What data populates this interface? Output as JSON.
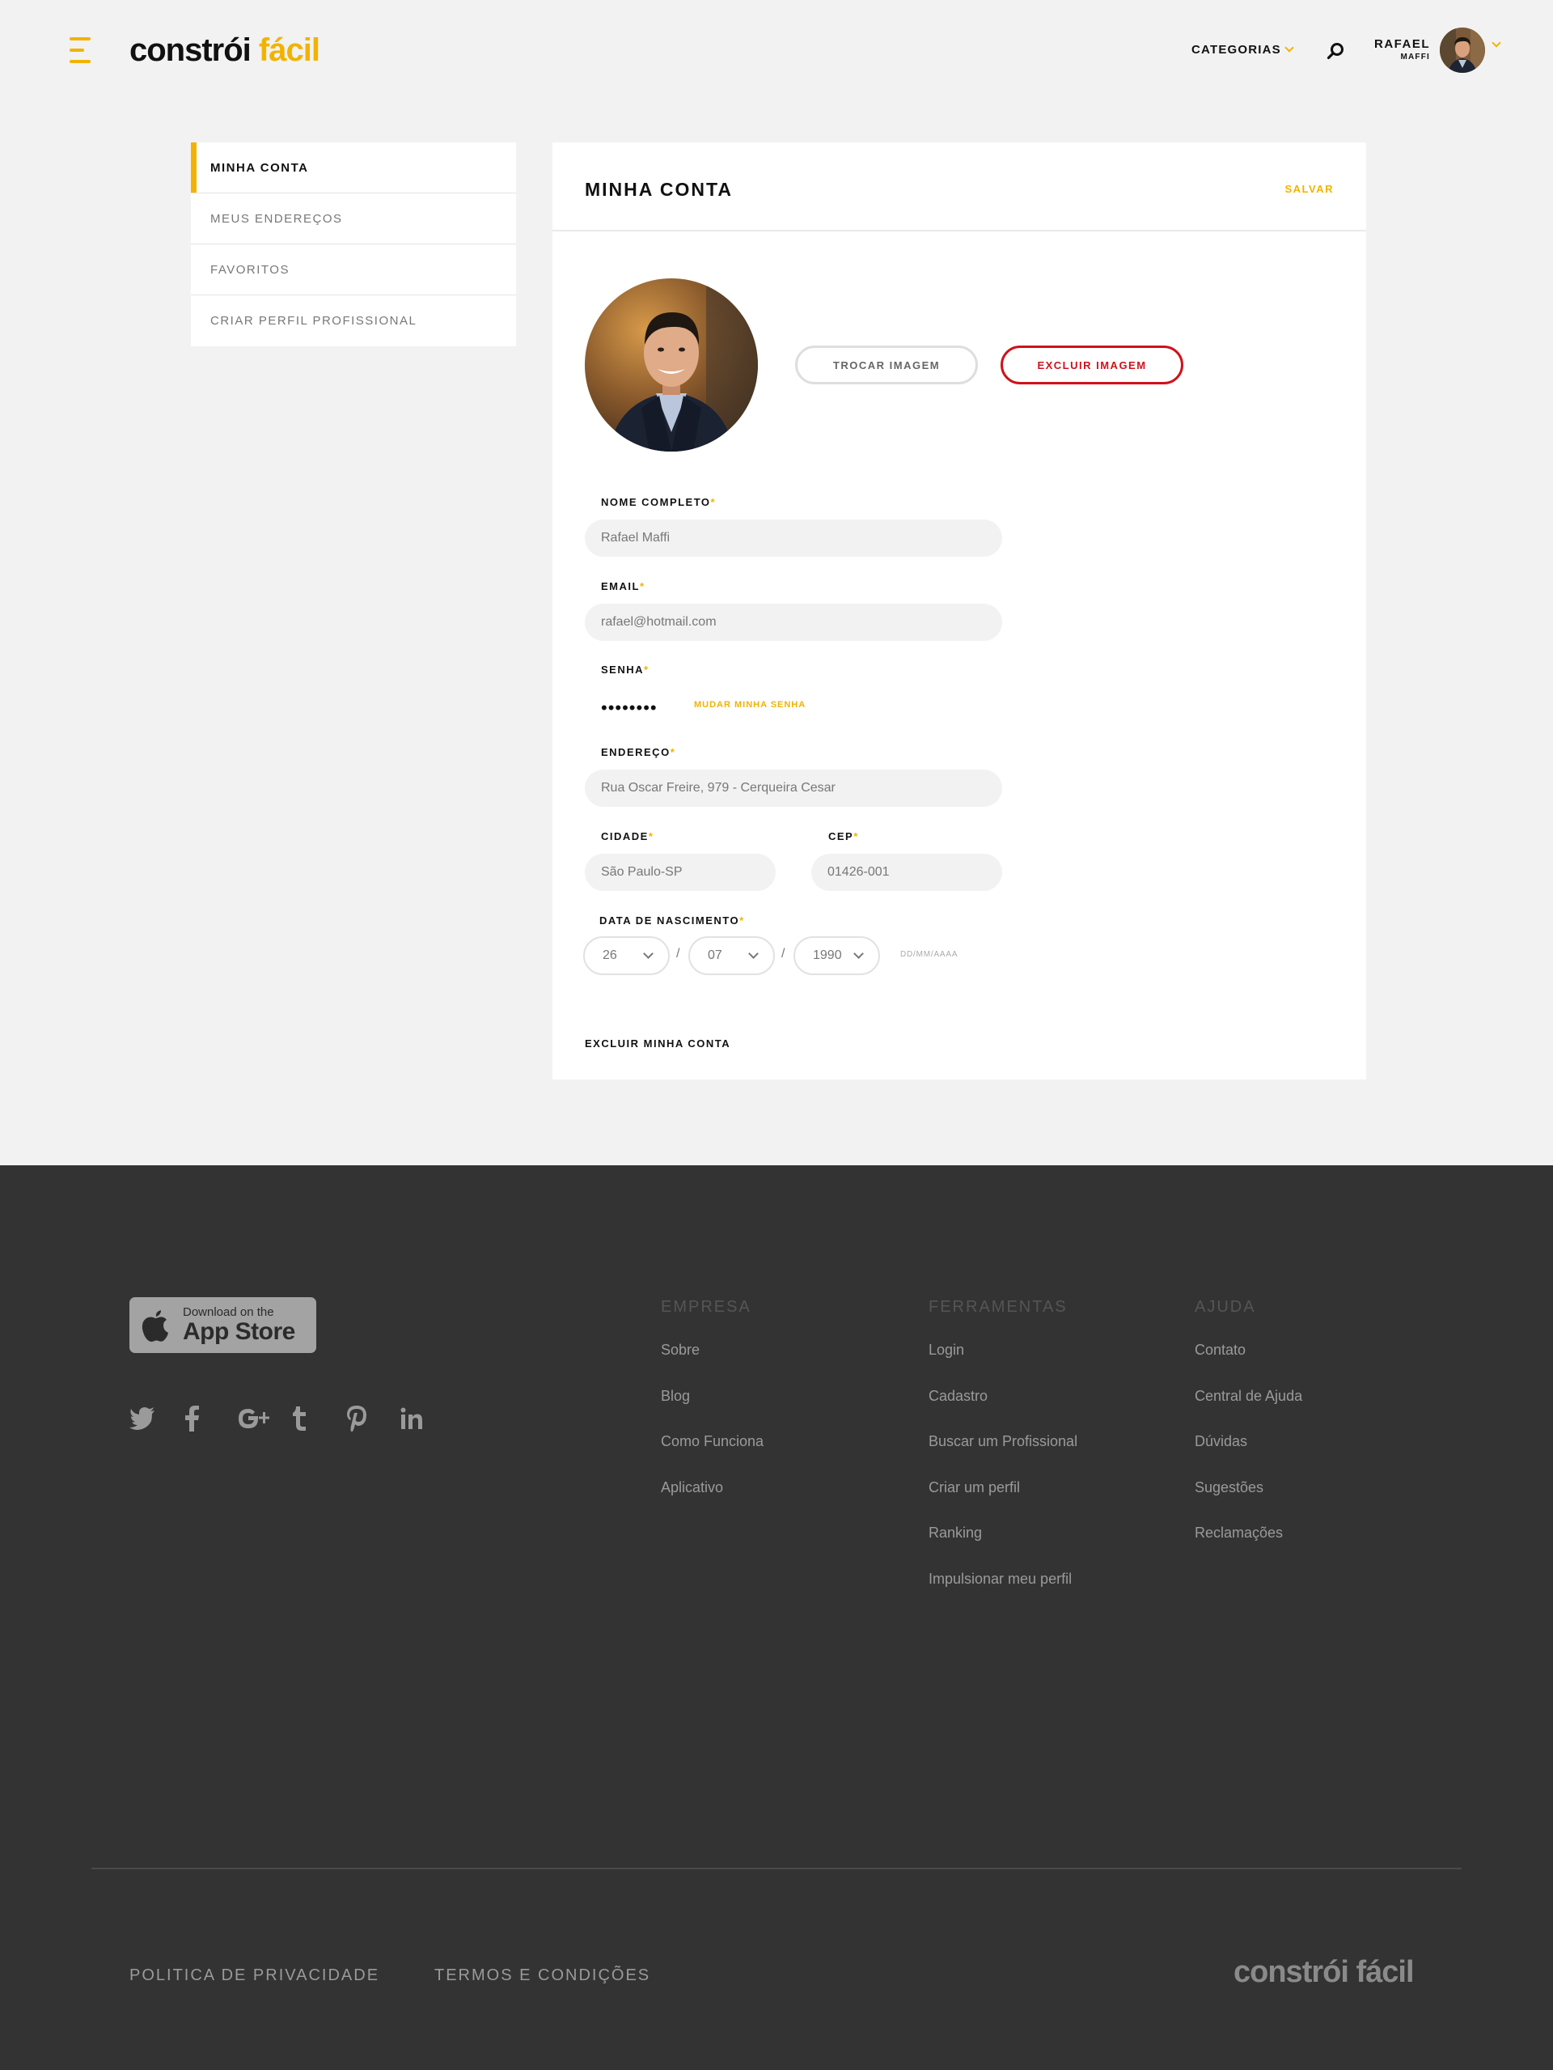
{
  "header": {
    "logo_part1": "constrói",
    "logo_part2": "fácil",
    "categories_label": "CATEGORIAS",
    "user_first_name": "RAFAEL",
    "user_last_name": "MAFFI"
  },
  "sidebar": {
    "items": [
      {
        "label": "MINHA CONTA"
      },
      {
        "label": "MEUS ENDEREÇOS"
      },
      {
        "label": "FAVORITOS"
      },
      {
        "label": "CRIAR PERFIL PROFISSIONAL"
      }
    ]
  },
  "account": {
    "title": "MINHA CONTA",
    "save_label": "SALVAR",
    "change_image_label": "TROCAR IMAGEM",
    "delete_image_label": "EXCLUIR IMAGEM",
    "required_mark": "*",
    "fields": {
      "full_name": {
        "label": "NOME COMPLETO",
        "value": "Rafael Maffi"
      },
      "email": {
        "label": "EMAIL",
        "value": "rafael@hotmail.com"
      },
      "password": {
        "label": "SENHA",
        "value": "••••••••",
        "change_label": "MUDAR MINHA SENHA"
      },
      "address": {
        "label": "ENDEREÇO",
        "value": "Rua Oscar Freire, 979 - Cerqueira Cesar"
      },
      "city": {
        "label": "CIDADE",
        "value": "São Paulo-SP"
      },
      "cep": {
        "label": "CEP",
        "value": "01426-001"
      },
      "birth_date": {
        "label": "DATA DE NASCIMENTO",
        "day": "26",
        "month": "07",
        "year": "1990",
        "separator": "/",
        "format_hint": "DD/MM/AAAA"
      }
    },
    "delete_account_label": "EXCLUIR MINHA CONTA"
  },
  "footer": {
    "appstore_small": "Download on the",
    "appstore_big": "App Store",
    "social": [
      "twitter-icon",
      "facebook-icon",
      "google-plus-icon",
      "tumblr-icon",
      "pinterest-icon",
      "linkedin-icon"
    ],
    "columns": [
      {
        "title": "EMPRESA",
        "links": [
          "Sobre",
          "Blog",
          "Como Funciona",
          "Aplicativo"
        ]
      },
      {
        "title": "FERRAMENTAS",
        "links": [
          "Login",
          "Cadastro",
          "Buscar um Profissional",
          "Criar um perfil",
          "Ranking",
          "Impulsionar meu perfil"
        ]
      },
      {
        "title": "AJUDA",
        "links": [
          "Contato",
          "Central de Ajuda",
          "Dúvidas",
          "Sugestões",
          "Reclamações"
        ]
      }
    ],
    "privacy_label": "POLITICA DE PRIVACIDADE",
    "terms_label": "TERMOS E CONDIÇÕES",
    "logo_text": "constrói fácil"
  },
  "colors": {
    "accent": "#f2b300",
    "danger": "#d0111b",
    "footer_bg": "#333333",
    "page_bg": "#f2f2f2"
  }
}
